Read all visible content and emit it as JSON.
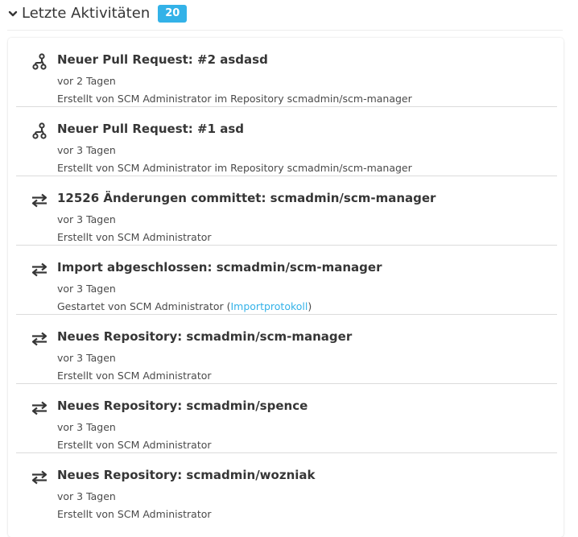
{
  "header": {
    "title": "Letzte Aktivitäten",
    "count": "20",
    "chevron_icon": "chevron-down-icon",
    "badge_color": "#33b2e8"
  },
  "items": [
    {
      "icon": "pull-request-icon",
      "title": "Neuer Pull Request: #2 asdasd",
      "time": "vor 2 Tagen",
      "description": "Erstellt von SCM Administrator im Repository scmadmin/scm-manager"
    },
    {
      "icon": "pull-request-icon",
      "title": "Neuer Pull Request: #1 asd",
      "time": "vor 3 Tagen",
      "description": "Erstellt von SCM Administrator im Repository scmadmin/scm-manager"
    },
    {
      "icon": "exchange-icon",
      "title": "12526 Änderungen committet: scmadmin/scm-manager",
      "time": "vor 3 Tagen",
      "description": "Erstellt von SCM Administrator"
    },
    {
      "icon": "exchange-icon",
      "title": "Import abgeschlossen: scmadmin/scm-manager",
      "time": "vor 3 Tagen",
      "description_prefix": "Gestartet von SCM Administrator (",
      "link": "Importprotokoll",
      "description_suffix": ")"
    },
    {
      "icon": "exchange-icon",
      "title": "Neues Repository: scmadmin/scm-manager",
      "time": "vor 3 Tagen",
      "description": "Erstellt von SCM Administrator"
    },
    {
      "icon": "exchange-icon",
      "title": "Neues Repository: scmadmin/spence",
      "time": "vor 3 Tagen",
      "description": "Erstellt von SCM Administrator"
    },
    {
      "icon": "exchange-icon",
      "title": "Neues Repository: scmadmin/wozniak",
      "time": "vor 3 Tagen",
      "description": "Erstellt von SCM Administrator"
    }
  ]
}
